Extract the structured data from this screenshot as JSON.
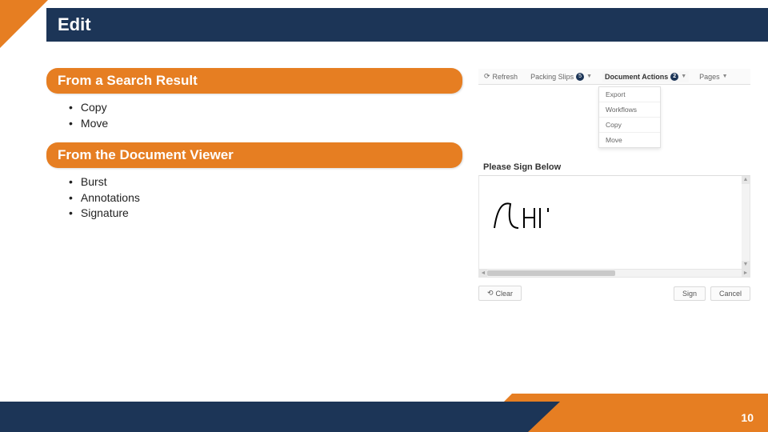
{
  "title": "Edit",
  "sections": [
    {
      "heading": "From a Search Result",
      "items": [
        "Copy",
        "Move"
      ]
    },
    {
      "heading": "From the Document Viewer",
      "items": [
        "Burst",
        "Annotations",
        "Signature"
      ]
    }
  ],
  "toolbar": {
    "refresh": "Refresh",
    "packing_slips": {
      "label": "Packing Slips",
      "count": "5"
    },
    "document_actions": {
      "label": "Document Actions",
      "count": "2"
    },
    "pages": "Pages"
  },
  "dropdown": [
    "Export",
    "Workflows",
    "Copy",
    "Move"
  ],
  "signature": {
    "prompt": "Please Sign Below",
    "clear": "Clear",
    "sign": "Sign",
    "cancel": "Cancel"
  },
  "page_number": "10"
}
